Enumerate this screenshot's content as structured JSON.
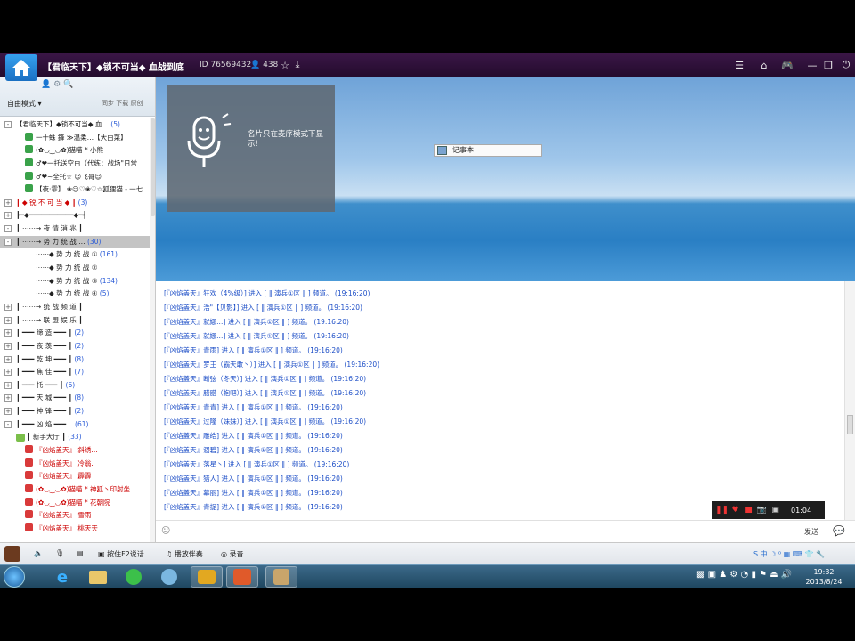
{
  "window": {
    "room_title": "【君临天下】◆锁不可当◆ 血战到底",
    "room_id": "ID 76569432",
    "online_count": "438"
  },
  "sidebar": {
    "mode_label": "自由模式",
    "mode_right": "同步 下载 原创",
    "tree": [
      {
        "text": "【君临天下】◆锁不可当◆ 血…",
        "count": "(5)",
        "type": "root",
        "exp": "-"
      },
      {
        "text": "一十蛛 鋒 ≫温柔…【大白菜】",
        "type": "user"
      },
      {
        "text": "(✿◡‿◡✿)猫喵 * 小熊",
        "type": "user"
      },
      {
        "text": "♂❤一托送空白（代练：战场\"日常",
        "type": "user"
      },
      {
        "text": "♂❤~全托☆ ☺飞哥☺",
        "type": "user"
      },
      {
        "text": "【夜·霏】 ❀☺♡❀♡☆狐狸猫 - 一七",
        "type": "user"
      },
      {
        "text": "┃ ◆ 锐 不 可 当 ◆ ┃",
        "count": "(3)",
        "type": "red",
        "exp": "+"
      },
      {
        "text": "┣━◆━━━━━━━━━━━◆━┫",
        "type": "plain",
        "exp": "+"
      },
      {
        "text": "┃ ⋯⋯→ 夜 情 消 兆 ┃",
        "type": "plain",
        "exp": "-"
      },
      {
        "text": "┃ ⋯⋯→ 势 力 统 战 …",
        "count": "(30)",
        "type": "sel",
        "exp": "-"
      },
      {
        "text": "⋯⋯◆ 势 力 统 战 ①",
        "count": "(161)",
        "type": "sub"
      },
      {
        "text": "⋯⋯◆ 势 力 统 战 ②",
        "type": "sub"
      },
      {
        "text": "⋯⋯◆ 势 力 统 战 ③",
        "count": "(134)",
        "type": "sub"
      },
      {
        "text": "⋯⋯◆ 势 力 统 战 ④",
        "count": "(5)",
        "type": "sub"
      },
      {
        "text": "┃ ⋯⋯→ 统 战 频 道 ┃",
        "type": "plain",
        "exp": "+"
      },
      {
        "text": "┃ ⋯⋯→ 联 盟 娱 乐 ┃",
        "type": "plain",
        "exp": "+"
      },
      {
        "text": "┃ ━━━ 缔 造 ━━━ ┃",
        "count": "(2)",
        "type": "plain",
        "exp": "+"
      },
      {
        "text": "┃ ━━━ 夜 羡 ━━━ ┃",
        "count": "(2)",
        "type": "plain",
        "exp": "+"
      },
      {
        "text": "┃ ━━━ 乾 坤 ━━━ ┃",
        "count": "(8)",
        "type": "plain",
        "exp": "+"
      },
      {
        "text": "┃ ━━━ 焦 佳 ━━━ ┃",
        "count": "(7)",
        "type": "plain",
        "exp": "+"
      },
      {
        "text": "┃ ━━━ 托 ━━━ ┃",
        "count": "(6)",
        "type": "plain",
        "exp": "+"
      },
      {
        "text": "┃ ━━━ 天 城 ━━━ ┃",
        "count": "(8)",
        "type": "plain",
        "exp": "+"
      },
      {
        "text": "┃ ━━━ 神 锋 ━━━ ┃",
        "count": "(2)",
        "type": "plain",
        "exp": "+"
      },
      {
        "text": "┃ ━━━ 凶 焰 ━━━…",
        "count": "(61)",
        "type": "plain",
        "exp": "-"
      },
      {
        "text": "┃ 新手大厅 ┃",
        "count": "(33)",
        "type": "lobby"
      },
      {
        "text": "『凶焰盖天』 斜绣…",
        "type": "member"
      },
      {
        "text": "『凶焰盖天』 冷翁.",
        "type": "member"
      },
      {
        "text": "『凶焰盖天』 霹霹",
        "type": "member"
      },
      {
        "text": "(✿◡‿◡✿)猫喵 * 神狐丶印射坐",
        "type": "member"
      },
      {
        "text": "(✿◡‿◡✿)猫喵 * 花朝院",
        "type": "member"
      },
      {
        "text": "『凶焰盖天』 雪雨",
        "type": "member"
      },
      {
        "text": "『凶焰盖天』 桃天天",
        "type": "member"
      }
    ]
  },
  "banner": {
    "mic_text": "名片只在麦序模式下显示!",
    "notepad_label": "记事本"
  },
  "chat": {
    "lines": [
      "[『凶焰盖天』狂欢（4%级）] 进入 [ ‖ 演兵①区 ‖ ] 频道。 (19:16:20)",
      "[『凶焰盖天』浩\"【贝影】] 进入 [ ‖ 演兵①区 ‖ ] 频道。 (19:16:20)",
      "[『凶焰盖天』就娜...] 进入 [ ‖ 演兵①区 ‖ ] 频道。 (19:16:20)",
      "[『凶焰盖天』就娜...] 进入 [ ‖ 演兵①区 ‖ ] 频道。 (19:16:20)",
      "[『凶焰盖天』青雨] 进入 [ ‖ 演兵①区 ‖ ] 频道。 (19:16:20)",
      "[『凶焰盖天』罗王（霸天敢丶）] 进入 [ ‖ 演兵①区 ‖ ] 频道。 (19:16:20)",
      "[『凶焰盖天』断弦（冬天）] 进入 [ ‖ 演兵①区 ‖ ] 频道。 (19:16:20)",
      "[『凶焰盖天』腊腊（抱吧）] 进入 [ ‖ 演兵①区 ‖ ] 频道。 (19:16:20)",
      "[『凶焰盖天』青青] 进入 [ ‖ 演兵①区 ‖ ] 频道。 (19:16:20)",
      "[『凶焰盖天』过隆（妹妹）] 进入 [ ‖ 演兵①区 ‖ ] 频道。 (19:16:20)",
      "[『凶焰盖天』雕皓] 进入 [ ‖ 演兵①区 ‖ ] 频道。 (19:16:20)",
      "[『凶焰盖天』涸碧] 进入 [ ‖ 演兵①区 ‖ ] 频道。 (19:16:20)",
      "[『凶焰盖天』落星丶] 进入 [ ‖ 演兵①区 ‖ ] 频道。 (19:16:20)",
      "[『凶焰盖天』猎人] 进入 [ ‖ 演兵①区 ‖ ] 频道。 (19:16:20)",
      "[『凶焰盖天』幕丽] 进入 [ ‖ 演兵①区 ‖ ] 频道。 (19:16:20)",
      "[『凶焰盖天』青捉] 进入 [ ‖ 演兵①区 ‖ ] 频道。 (19:16:20)"
    ],
    "record_time": "01:04",
    "send_label": "发送"
  },
  "bottombar": {
    "hold_to_talk": "按住F2说话",
    "music": "播放伴奏",
    "record": "录音"
  },
  "taskbar": {
    "time": "19:32",
    "date": "2013/8/24"
  },
  "colors": {
    "titlebar": "#2d0f38",
    "chat_text": "#1e4fc7",
    "count_text": "#2a5bd7",
    "channel_red": "#cc0000"
  }
}
